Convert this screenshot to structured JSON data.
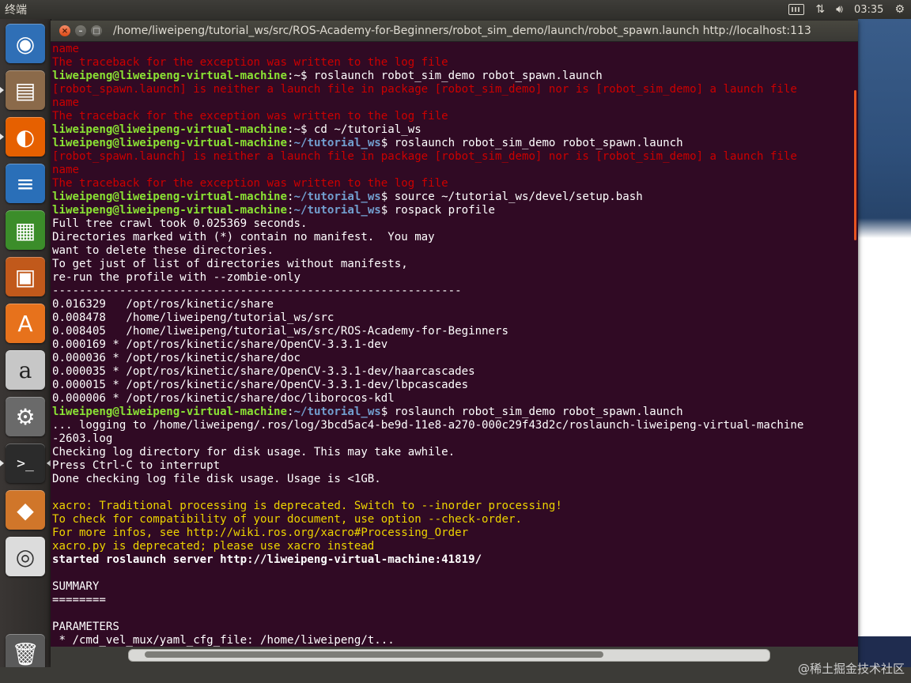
{
  "topbar": {
    "app_title": "终端",
    "clock": "03:35",
    "icons": [
      "keyboard-icon",
      "network-icon",
      "volume-icon",
      "gear-icon"
    ]
  },
  "launcher": {
    "items": [
      {
        "name": "ubuntu-dash",
        "glyph": "◉",
        "bg": "#2f6fb6"
      },
      {
        "name": "files",
        "glyph": "▤",
        "bg": "#8b6a4a"
      },
      {
        "name": "firefox",
        "glyph": "◐",
        "bg": "#e66000"
      },
      {
        "name": "libreoffice-writer",
        "glyph": "≡",
        "bg": "#2a6fb8"
      },
      {
        "name": "libreoffice-calc",
        "glyph": "▦",
        "bg": "#3b8d2a"
      },
      {
        "name": "libreoffice-impress",
        "glyph": "▣",
        "bg": "#c1591b"
      },
      {
        "name": "software-center",
        "glyph": "A",
        "bg": "#e7721c"
      },
      {
        "name": "amazon",
        "glyph": "a",
        "bg": "#c7c7c7"
      },
      {
        "name": "system-settings",
        "glyph": "⚙",
        "bg": "#6a6a6a"
      },
      {
        "name": "terminal",
        "glyph": ">_",
        "bg": "#2b2b2b"
      },
      {
        "name": "blender-like-app",
        "glyph": "◆",
        "bg": "#d0762a"
      },
      {
        "name": "dvd",
        "glyph": "◎",
        "bg": "#dcdcdc"
      },
      {
        "name": "trash",
        "glyph": "🗑",
        "bg": "#5a5a5a"
      }
    ]
  },
  "window": {
    "title": "/home/liweipeng/tutorial_ws/src/ROS-Academy-for-Beginners/robot_sim_demo/launch/robot_spawn.launch http://localhost:113",
    "close_label": "×",
    "min_label": "–",
    "max_label": "□"
  },
  "colors": {
    "terminal_bg": "#300a24",
    "prompt_green": "#8ae234",
    "path_blue": "#729fcf",
    "error_red": "#cc0000",
    "warn_yellow": "#edd400",
    "scrollbar_accent": "#e95420"
  },
  "terminal": {
    "lines": [
      [
        {
          "t": "name",
          "c": "red"
        }
      ],
      [
        {
          "t": "The traceback for the exception was written to the log file",
          "c": "red"
        }
      ],
      [
        {
          "t": "liweipeng@liweipeng-virtual-machine",
          "c": "prompt"
        },
        {
          "t": ":~$ roslaunch robot_sim_demo robot_spawn.launch",
          "c": ""
        }
      ],
      [
        {
          "t": "[robot_spawn.launch] is neither a launch file in package [robot_sim_demo] nor is [robot_sim_demo] a launch file",
          "c": "red"
        }
      ],
      [
        {
          "t": "name",
          "c": "red"
        }
      ],
      [
        {
          "t": "The traceback for the exception was written to the log file",
          "c": "red"
        }
      ],
      [
        {
          "t": "liweipeng@liweipeng-virtual-machine",
          "c": "prompt"
        },
        {
          "t": ":~$ cd ~/tutorial_ws",
          "c": ""
        }
      ],
      [
        {
          "t": "liweipeng@liweipeng-virtual-machine",
          "c": "prompt"
        },
        {
          "t": ":",
          "c": ""
        },
        {
          "t": "~/tutorial_ws",
          "c": "path"
        },
        {
          "t": "$ roslaunch robot_sim_demo robot_spawn.launch",
          "c": ""
        }
      ],
      [
        {
          "t": "[robot_spawn.launch] is neither a launch file in package [robot_sim_demo] nor is [robot_sim_demo] a launch file",
          "c": "red"
        }
      ],
      [
        {
          "t": "name",
          "c": "red"
        }
      ],
      [
        {
          "t": "The traceback for the exception was written to the log file",
          "c": "red"
        }
      ],
      [
        {
          "t": "liweipeng@liweipeng-virtual-machine",
          "c": "prompt"
        },
        {
          "t": ":",
          "c": ""
        },
        {
          "t": "~/tutorial_ws",
          "c": "path"
        },
        {
          "t": "$ source ~/tutorial_ws/devel/setup.bash",
          "c": ""
        }
      ],
      [
        {
          "t": "liweipeng@liweipeng-virtual-machine",
          "c": "prompt"
        },
        {
          "t": ":",
          "c": ""
        },
        {
          "t": "~/tutorial_ws",
          "c": "path"
        },
        {
          "t": "$ rospack profile",
          "c": ""
        }
      ],
      [
        {
          "t": "Full tree crawl took 0.025369 seconds.",
          "c": ""
        }
      ],
      [
        {
          "t": "Directories marked with (*) contain no manifest.  You may",
          "c": ""
        }
      ],
      [
        {
          "t": "want to delete these directories.",
          "c": ""
        }
      ],
      [
        {
          "t": "To get just of list of directories without manifests,",
          "c": ""
        }
      ],
      [
        {
          "t": "re-run the profile with --zombie-only",
          "c": ""
        }
      ],
      [
        {
          "t": "-------------------------------------------------------------",
          "c": ""
        }
      ],
      [
        {
          "t": "0.016329   /opt/ros/kinetic/share",
          "c": ""
        }
      ],
      [
        {
          "t": "0.008478   /home/liweipeng/tutorial_ws/src",
          "c": ""
        }
      ],
      [
        {
          "t": "0.008405   /home/liweipeng/tutorial_ws/src/ROS-Academy-for-Beginners",
          "c": ""
        }
      ],
      [
        {
          "t": "0.000169 * /opt/ros/kinetic/share/OpenCV-3.3.1-dev",
          "c": ""
        }
      ],
      [
        {
          "t": "0.000036 * /opt/ros/kinetic/share/doc",
          "c": ""
        }
      ],
      [
        {
          "t": "0.000035 * /opt/ros/kinetic/share/OpenCV-3.3.1-dev/haarcascades",
          "c": ""
        }
      ],
      [
        {
          "t": "0.000015 * /opt/ros/kinetic/share/OpenCV-3.3.1-dev/lbpcascades",
          "c": ""
        }
      ],
      [
        {
          "t": "0.000006 * /opt/ros/kinetic/share/doc/liborocos-kdl",
          "c": ""
        }
      ],
      [
        {
          "t": "liweipeng@liweipeng-virtual-machine",
          "c": "prompt"
        },
        {
          "t": ":",
          "c": ""
        },
        {
          "t": "~/tutorial_ws",
          "c": "path"
        },
        {
          "t": "$ roslaunch robot_sim_demo robot_spawn.launch",
          "c": ""
        }
      ],
      [
        {
          "t": "... logging to /home/liweipeng/.ros/log/3bcd5ac4-be9d-11e8-a270-000c29f43d2c/roslaunch-liweipeng-virtual-machine",
          "c": ""
        }
      ],
      [
        {
          "t": "-2603.log",
          "c": ""
        }
      ],
      [
        {
          "t": "Checking log directory for disk usage. This may take awhile.",
          "c": ""
        }
      ],
      [
        {
          "t": "Press Ctrl-C to interrupt",
          "c": ""
        }
      ],
      [
        {
          "t": "Done checking log file disk usage. Usage is <1GB.",
          "c": ""
        }
      ],
      [
        {
          "t": "",
          "c": ""
        }
      ],
      [
        {
          "t": "xacro: Traditional processing is deprecated. Switch to --inorder processing!",
          "c": "yellow"
        }
      ],
      [
        {
          "t": "To check for compatibility of your document, use option --check-order.",
          "c": "yellow"
        }
      ],
      [
        {
          "t": "For more infos, see http://wiki.ros.org/xacro#Processing_Order",
          "c": "yellow"
        }
      ],
      [
        {
          "t": "xacro.py is deprecated; please use xacro instead",
          "c": "yellow"
        }
      ],
      [
        {
          "t": "started roslaunch server http://liweipeng-virtual-machine:41819/",
          "c": "bold"
        }
      ],
      [
        {
          "t": "",
          "c": ""
        }
      ],
      [
        {
          "t": "SUMMARY",
          "c": ""
        }
      ],
      [
        {
          "t": "========",
          "c": ""
        }
      ],
      [
        {
          "t": "",
          "c": ""
        }
      ],
      [
        {
          "t": "PARAMETERS",
          "c": ""
        }
      ],
      [
        {
          "t": " * /cmd_vel_mux/yaml_cfg_file: /home/liweipeng/t...",
          "c": ""
        }
      ]
    ]
  },
  "watermark": "@稀土掘金技术社区"
}
